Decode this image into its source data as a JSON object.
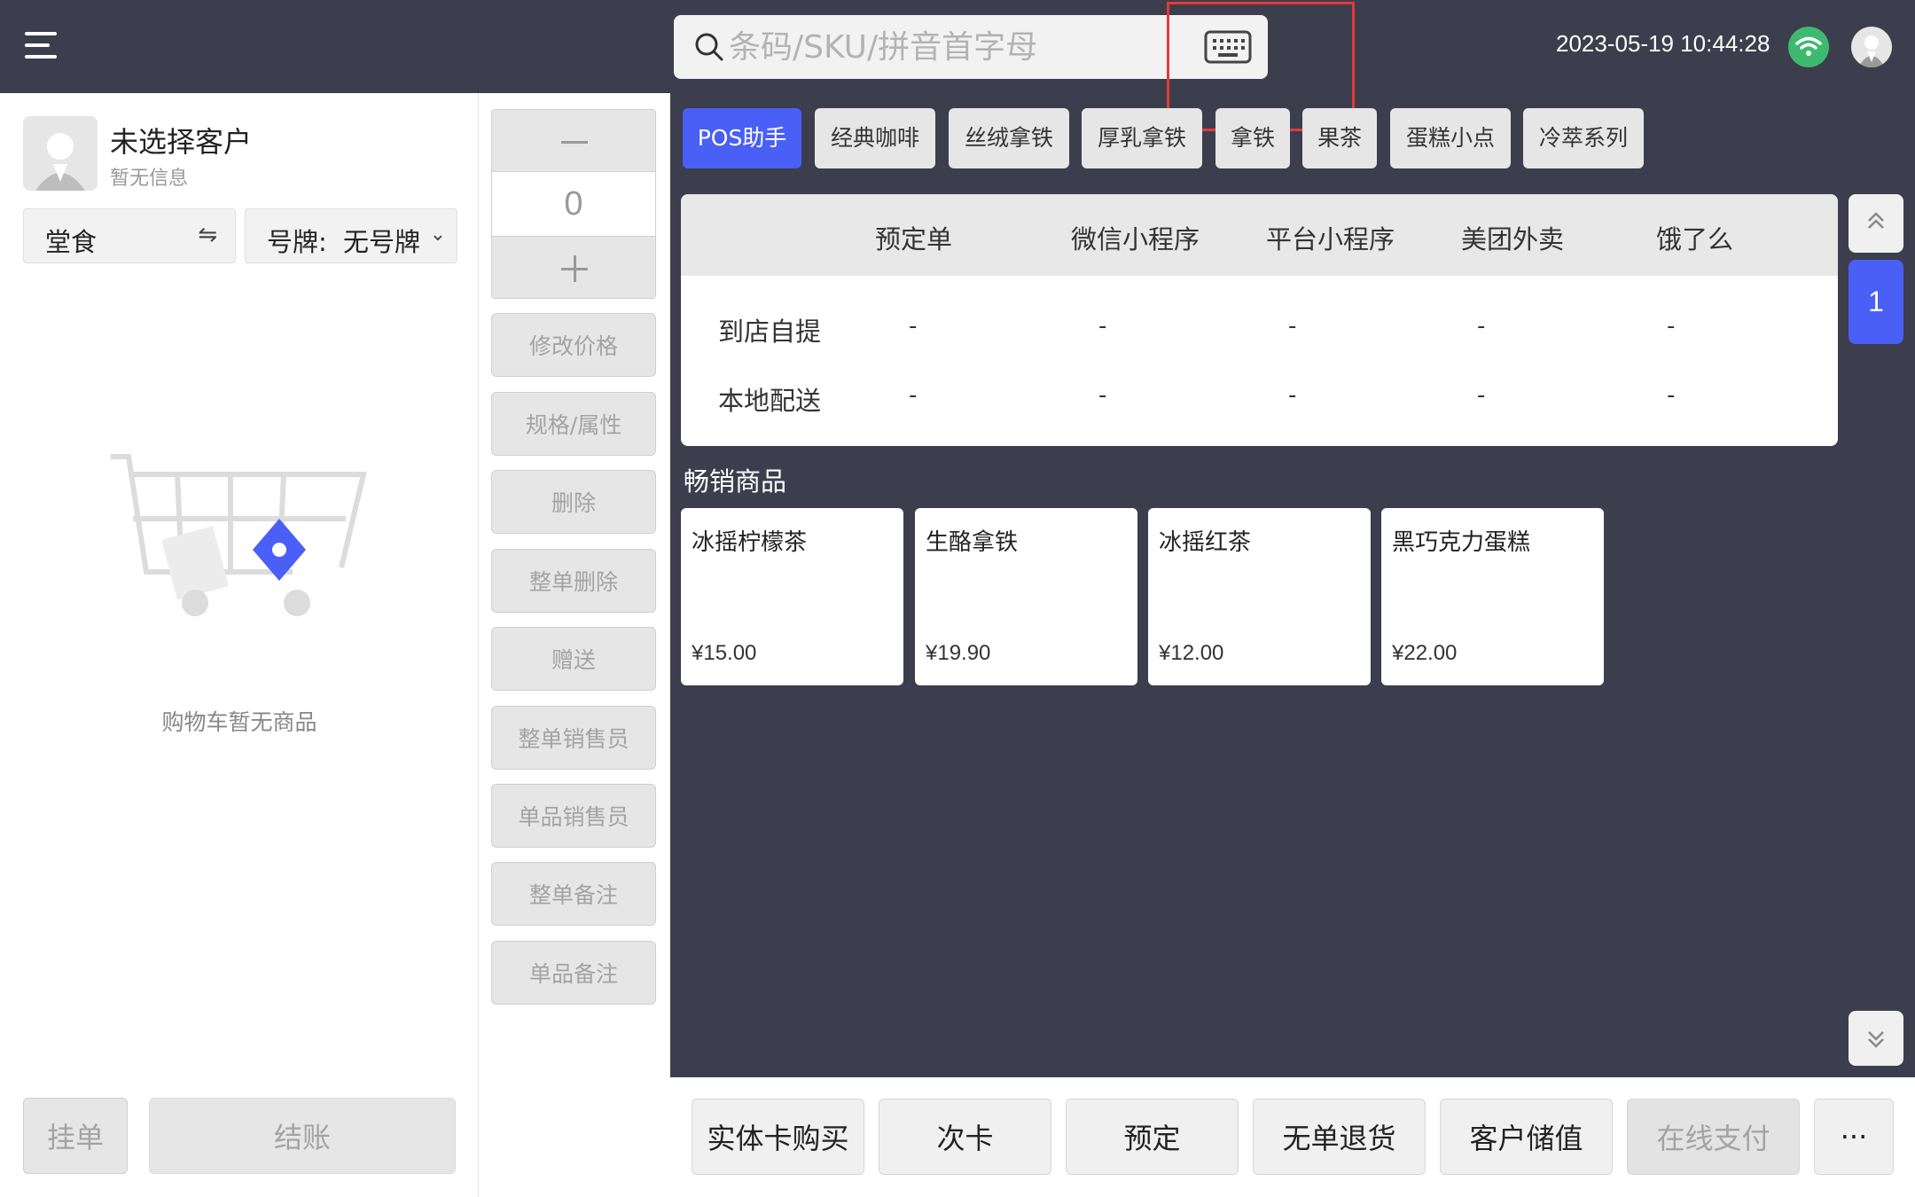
{
  "header": {
    "search_placeholder": "条码/SKU/拼音首字母",
    "datetime": "2023-05-19 10:44:28",
    "icons": [
      "menu-icon",
      "search-icon",
      "keyboard-icon",
      "wifi-icon",
      "user-avatar"
    ]
  },
  "customer": {
    "name": "未选择客户",
    "info": "暂无信息"
  },
  "order": {
    "dine_type": "堂食",
    "plate_label": "号牌:",
    "plate_value": "无号牌"
  },
  "cart": {
    "empty_text": "购物车暂无商品",
    "hold_label": "挂单",
    "checkout_label": "结账"
  },
  "quantity": {
    "value": "0"
  },
  "actions": [
    {
      "label": "修改价格"
    },
    {
      "label": "规格/属性"
    },
    {
      "label": "删除"
    },
    {
      "label": "整单删除"
    },
    {
      "label": "赠送"
    },
    {
      "label": "整单销售员"
    },
    {
      "label": "单品销售员"
    },
    {
      "label": "整单备注"
    },
    {
      "label": "单品备注"
    }
  ],
  "tabs": [
    {
      "label": "POS助手",
      "active": true
    },
    {
      "label": "经典咖啡"
    },
    {
      "label": "丝绒拿铁"
    },
    {
      "label": "厚乳拿铁"
    },
    {
      "label": "拿铁"
    },
    {
      "label": "果茶"
    },
    {
      "label": "蛋糕小点"
    },
    {
      "label": "冷萃系列"
    }
  ],
  "channels": {
    "columns": [
      "预定单",
      "微信小程序",
      "平台小程序",
      "美团外卖",
      "饿了么"
    ],
    "rows": [
      {
        "label": "到店自提",
        "values": [
          "-",
          "-",
          "-",
          "-",
          "-"
        ]
      },
      {
        "label": "本地配送",
        "values": [
          "-",
          "-",
          "-",
          "-",
          "-"
        ]
      }
    ]
  },
  "pagination": {
    "current": "1"
  },
  "bestsellers": {
    "title": "畅销商品",
    "items": [
      {
        "name": "冰摇柠檬茶",
        "price": "¥15.00"
      },
      {
        "name": "生酪拿铁",
        "price": "¥19.90"
      },
      {
        "name": "冰摇红茶",
        "price": "¥12.00"
      },
      {
        "name": "黑巧克力蛋糕",
        "price": "¥22.00"
      }
    ]
  },
  "bottom_actions": [
    {
      "label": "实体卡购买"
    },
    {
      "label": "次卡"
    },
    {
      "label": "预定"
    },
    {
      "label": "无单退货"
    },
    {
      "label": "客户储值"
    },
    {
      "label": "在线支付",
      "disabled": true
    },
    {
      "label": "···"
    }
  ],
  "colors": {
    "dark_bg": "#3c3e4d",
    "accent": "#4a5ff5",
    "wifi": "#3dba6f",
    "highlight": "#e53935"
  }
}
